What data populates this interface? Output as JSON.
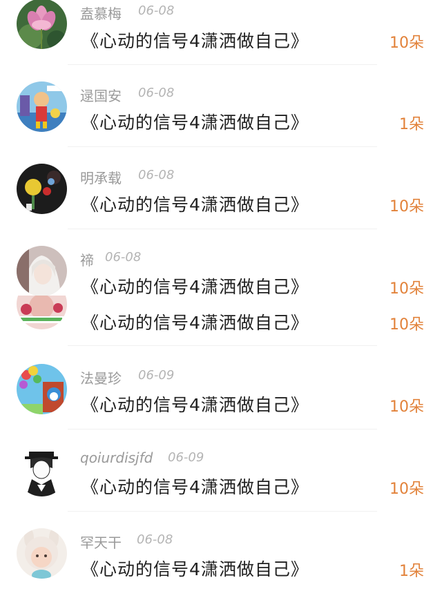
{
  "gifts": [
    {
      "name": "盍慕梅",
      "date": "06-08",
      "title": "《心动的信号4潇洒做自己》",
      "count": "10朵",
      "avatar_icon": "lotus-flower-avatar"
    },
    {
      "name": "逯国安",
      "date": "06-08",
      "title": "《心动的信号4潇洒做自己》",
      "count": "1朵",
      "avatar_icon": "cartoon-superhero-avatar"
    },
    {
      "name": "明承载",
      "date": "06-08",
      "title": "《心动的信号4潇洒做自己》",
      "count": "10朵",
      "avatar_icon": "wind-chime-avatar"
    },
    {
      "name": "禘",
      "date": "06-08",
      "title": "《心动的信号4潇洒做自己》",
      "count": "10朵",
      "avatar_icon": "anime-girl-avatar"
    },
    {
      "name": "",
      "date": "",
      "title": "《心动的信号4潇洒做自己》",
      "count": "10朵",
      "avatar_icon": "girl-photo-avatar"
    },
    {
      "name": "法曼珍",
      "date": "06-09",
      "title": "《心动的信号4潇洒做自己》",
      "count": "10朵",
      "avatar_icon": "balloons-doraemon-avatar"
    },
    {
      "name": "qoiurdisjfd",
      "date": "06-09",
      "title": "《心动的信号4潇洒做自己》",
      "count": "10朵",
      "avatar_icon": "anime-boy-hat-avatar"
    },
    {
      "name": "罕天干",
      "date": "06-08",
      "title": "《心动的信号4潇洒做自己》",
      "count": "1朵",
      "avatar_icon": "child-bunny-hat-avatar"
    }
  ],
  "colors": {
    "count": "#e2823a",
    "name": "#9a9a9a",
    "date": "#b4b4b4",
    "title": "#1f1f1f"
  }
}
